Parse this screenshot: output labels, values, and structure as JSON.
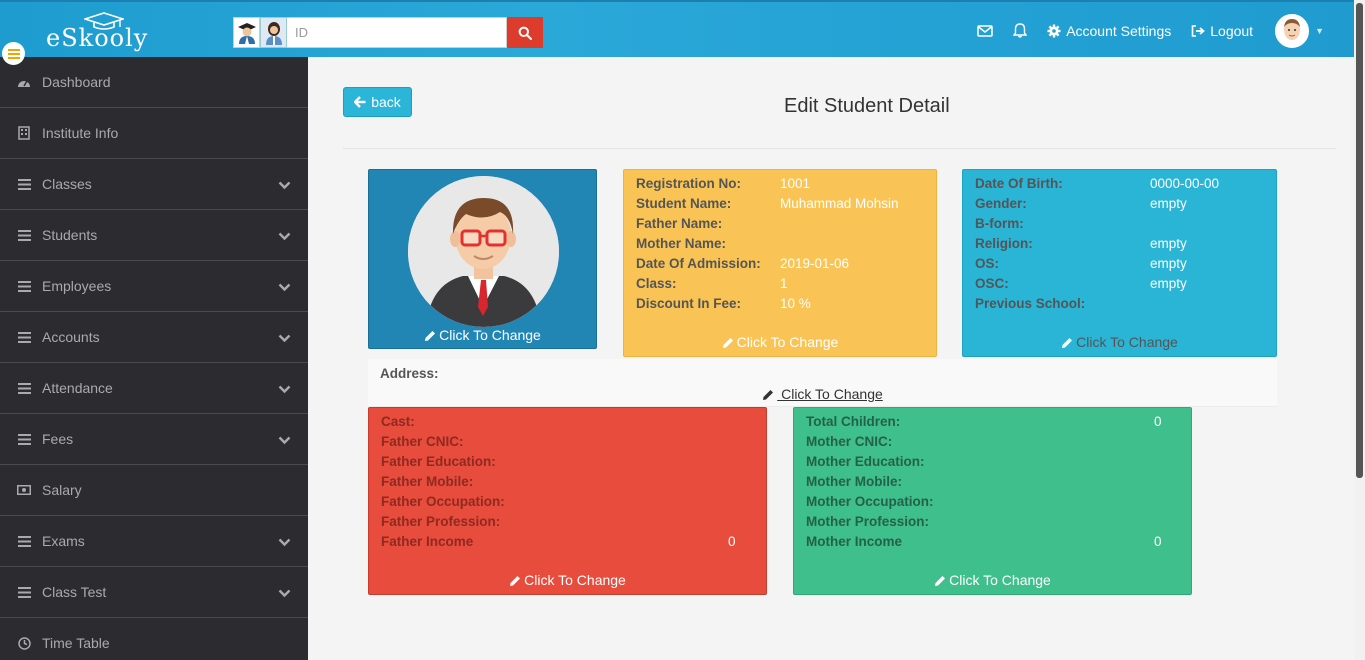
{
  "header": {
    "logo_text": "eSkooly",
    "search_placeholder": "ID",
    "nav": {
      "account_settings": "Account Settings",
      "logout": "Logout"
    }
  },
  "sidebar": {
    "items": [
      {
        "label": "Dashboard",
        "icon": "dashboard-icon",
        "expandable": false
      },
      {
        "label": "Institute Info",
        "icon": "building-icon",
        "expandable": false
      },
      {
        "label": "Classes",
        "icon": "menu-icon",
        "expandable": true
      },
      {
        "label": "Students",
        "icon": "menu-icon",
        "expandable": true
      },
      {
        "label": "Employees",
        "icon": "menu-icon",
        "expandable": true
      },
      {
        "label": "Accounts",
        "icon": "menu-icon",
        "expandable": true
      },
      {
        "label": "Attendance",
        "icon": "menu-icon",
        "expandable": true
      },
      {
        "label": "Fees",
        "icon": "menu-icon",
        "expandable": true
      },
      {
        "label": "Salary",
        "icon": "money-icon",
        "expandable": false
      },
      {
        "label": "Exams",
        "icon": "menu-icon",
        "expandable": true
      },
      {
        "label": "Class Test",
        "icon": "menu-icon",
        "expandable": true
      },
      {
        "label": "Time Table",
        "icon": "clock-icon",
        "expandable": false
      }
    ]
  },
  "main": {
    "back_label": "back",
    "title": "Edit Student Detail",
    "change_label": "Click To Change",
    "change_label_address": " Click To Change",
    "student_info": {
      "fields": [
        {
          "label": "Registration No:",
          "value": "1001"
        },
        {
          "label": "Student Name:",
          "value": "Muhammad Mohsin"
        },
        {
          "label": "Father Name:",
          "value": ""
        },
        {
          "label": "Mother Name:",
          "value": ""
        },
        {
          "label": "Date Of Admission:",
          "value": "2019-01-06"
        },
        {
          "label": "Class:",
          "value": "1"
        },
        {
          "label": "Discount In Fee:",
          "value": "10 %"
        }
      ]
    },
    "personal_info": {
      "fields": [
        {
          "label": "Date Of Birth:",
          "value": "0000-00-00"
        },
        {
          "label": "Gender:",
          "value": "empty"
        },
        {
          "label": "B-form:",
          "value": ""
        },
        {
          "label": "Religion:",
          "value": "empty"
        },
        {
          "label": "OS:",
          "value": "empty"
        },
        {
          "label": "OSC:",
          "value": "empty"
        },
        {
          "label": "Previous School:",
          "value": ""
        }
      ]
    },
    "address": {
      "label": "Address:",
      "value": ""
    },
    "father_info": {
      "fields": [
        {
          "label": "Cast:",
          "value": ""
        },
        {
          "label": "Father CNIC:",
          "value": ""
        },
        {
          "label": "Father Education:",
          "value": ""
        },
        {
          "label": "Father Mobile:",
          "value": ""
        },
        {
          "label": "Father Occupation:",
          "value": ""
        },
        {
          "label": "Father Profession:",
          "value": ""
        },
        {
          "label": "Father Income",
          "value": "0"
        }
      ]
    },
    "mother_info": {
      "fields": [
        {
          "label": "Total Children:",
          "value": "0"
        },
        {
          "label": "Mother CNIC:",
          "value": ""
        },
        {
          "label": "Mother Education:",
          "value": ""
        },
        {
          "label": "Mother Mobile:",
          "value": ""
        },
        {
          "label": "Mother Occupation:",
          "value": ""
        },
        {
          "label": "Mother Profession:",
          "value": ""
        },
        {
          "label": "Mother Income",
          "value": "0"
        }
      ]
    }
  },
  "colors": {
    "header": "#1e9ccf",
    "sidebar": "#2c2c30",
    "photo_card": "#2286b5",
    "yellow_card": "#f9c455",
    "blue_card": "#2ab4d6",
    "red_card": "#e74c3c",
    "green_card": "#3fbf8b",
    "search_button": "#dd3c2c"
  }
}
